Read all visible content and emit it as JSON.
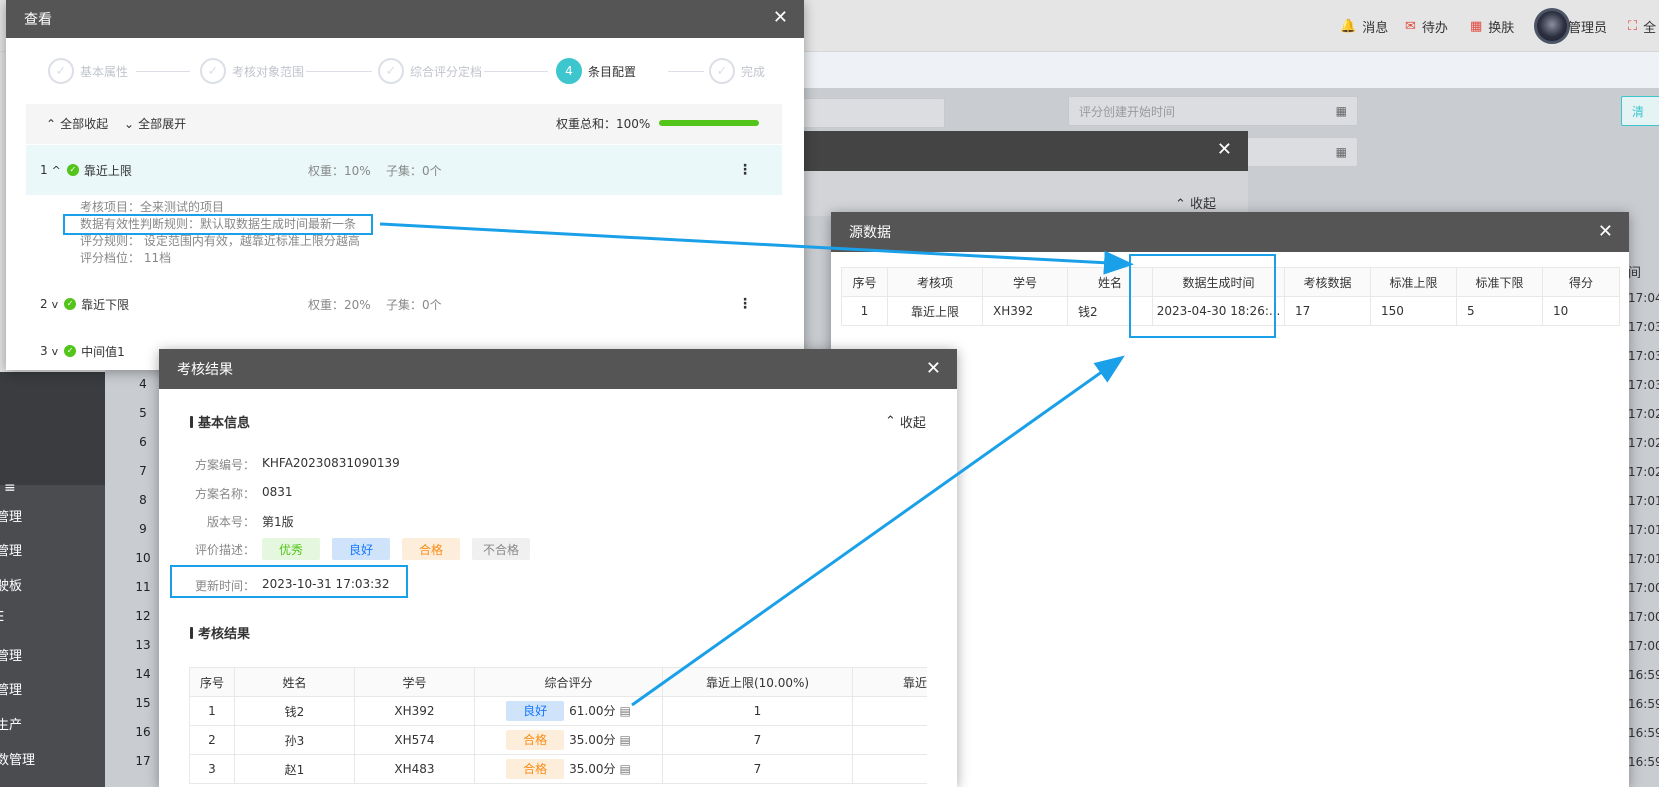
{
  "topbar": {
    "items": [
      {
        "icon": "bell-icon",
        "glyph": "🔔",
        "label": "消息"
      },
      {
        "icon": "mail-icon",
        "glyph": "✉",
        "label": "待办"
      },
      {
        "icon": "grid-icon",
        "glyph": "▦",
        "label": "换肤"
      },
      {
        "icon": "avatar",
        "glyph": "",
        "label": "管理员"
      },
      {
        "icon": "fullscreen-icon",
        "glyph": "⛶",
        "label": "全"
      }
    ]
  },
  "background": {
    "date_placeholder": "评分创建开始时间",
    "clear_label": "清",
    "time_col_header": "间",
    "sidebar_items": [
      "管理",
      "管理",
      "驶板",
      "E",
      "管理",
      "管理",
      "生产",
      "数管理"
    ],
    "row_numbers": [
      "4",
      "5",
      "6",
      "7",
      "8",
      "9",
      "10",
      "11",
      "12",
      "13",
      "14",
      "15",
      "16",
      "17"
    ],
    "right_times": [
      "17:04",
      "17:03",
      "17:03",
      "17:03",
      "17:02",
      "17:02",
      "17:02",
      "17:01",
      "17:01",
      "17:01",
      "17:00",
      "17:00",
      "17:00",
      "16:59",
      "16:59",
      "16:59",
      "16:59"
    ],
    "mid_dialog_collapse": "收起"
  },
  "view_dialog": {
    "title": "查看",
    "steps": [
      {
        "label": "基本属性",
        "glyph": "✓",
        "state": "done"
      },
      {
        "label": "考核对象范围",
        "glyph": "✓",
        "state": "done"
      },
      {
        "label": "综合评分定档",
        "glyph": "✓",
        "state": "done"
      },
      {
        "label": "条目配置",
        "glyph": "4",
        "state": "active"
      },
      {
        "label": "完成",
        "glyph": "✓",
        "state": "pending"
      }
    ],
    "collapse_all": "全部收起",
    "expand_all": "全部展开",
    "weight_total": "权重总和：100%",
    "weight_progress": 1.0,
    "items": [
      {
        "index": "1",
        "arrow": "^",
        "name": "靠近上限",
        "weight": "权重：10%",
        "sub": "子集：0个"
      },
      {
        "index": "2",
        "arrow": "v",
        "name": "靠近下限",
        "weight": "权重：20%",
        "sub": "子集：0个"
      },
      {
        "index": "3",
        "arrow": "v",
        "name": "中间值1",
        "weight": "",
        "sub": ""
      }
    ],
    "details": [
      "考核项目：全来测试的项目",
      "数据有效性判断规则：默认取数据生成时间最新一条",
      "评分规则：  设定范围内有效，越靠近标准上限分越高",
      "评分档位：  11档"
    ]
  },
  "source_dialog": {
    "title": "源数据",
    "headers": [
      "序号",
      "考核项",
      "学号",
      "姓名",
      "数据生成时间",
      "考核数据",
      "标准上限",
      "标准下限",
      "得分"
    ],
    "rows": [
      [
        "1",
        "靠近上限",
        "XH392",
        "钱2",
        "2023-04-30 18:26:...",
        "17",
        "150",
        "5",
        "10"
      ]
    ]
  },
  "result_dialog": {
    "title": "考核结果",
    "basic_title": "基本信息",
    "collapse": "收起",
    "fields": [
      {
        "label": "方案编号：",
        "value": "KHFA20230831090139"
      },
      {
        "label": "方案名称：",
        "value": "0831"
      },
      {
        "label": "版本号：",
        "value": "第1版"
      }
    ],
    "eval_label": "评价描述：",
    "tags": [
      {
        "text": "优秀",
        "bg": "#e6f7df",
        "color": "#52c41a"
      },
      {
        "text": "良好",
        "bg": "#cfe4fb",
        "color": "#1677ff"
      },
      {
        "text": "合格",
        "bg": "#fdeedc",
        "color": "#fa8c16"
      },
      {
        "text": "不合格",
        "bg": "#f0f0f0",
        "color": "#888888"
      }
    ],
    "update_label": "更新时间：",
    "update_value": "2023-10-31 17:03:32",
    "result_title": "考核结果",
    "headers": [
      "序号",
      "姓名",
      "学号",
      "综合评分",
      "靠近上限(10.00%)",
      "靠近下"
    ],
    "rows": [
      {
        "no": "1",
        "name": "钱2",
        "id": "XH392",
        "grade": "良好",
        "grade_bg": "#cfe4fb",
        "grade_color": "#1677ff",
        "score": "61.00分",
        "v1": "1"
      },
      {
        "no": "2",
        "name": "孙3",
        "id": "XH574",
        "grade": "合格",
        "grade_bg": "#fdeedc",
        "grade_color": "#fa8c16",
        "score": "35.00分",
        "v1": "7"
      },
      {
        "no": "3",
        "name": "赵1",
        "id": "XH483",
        "grade": "合格",
        "grade_bg": "#fdeedc",
        "grade_color": "#fa8c16",
        "score": "35.00分",
        "v1": "7"
      }
    ]
  },
  "colors": {
    "annotation": "#1aa0e8",
    "active_step": "#3dc6ce",
    "progress": "#52c41a"
  }
}
